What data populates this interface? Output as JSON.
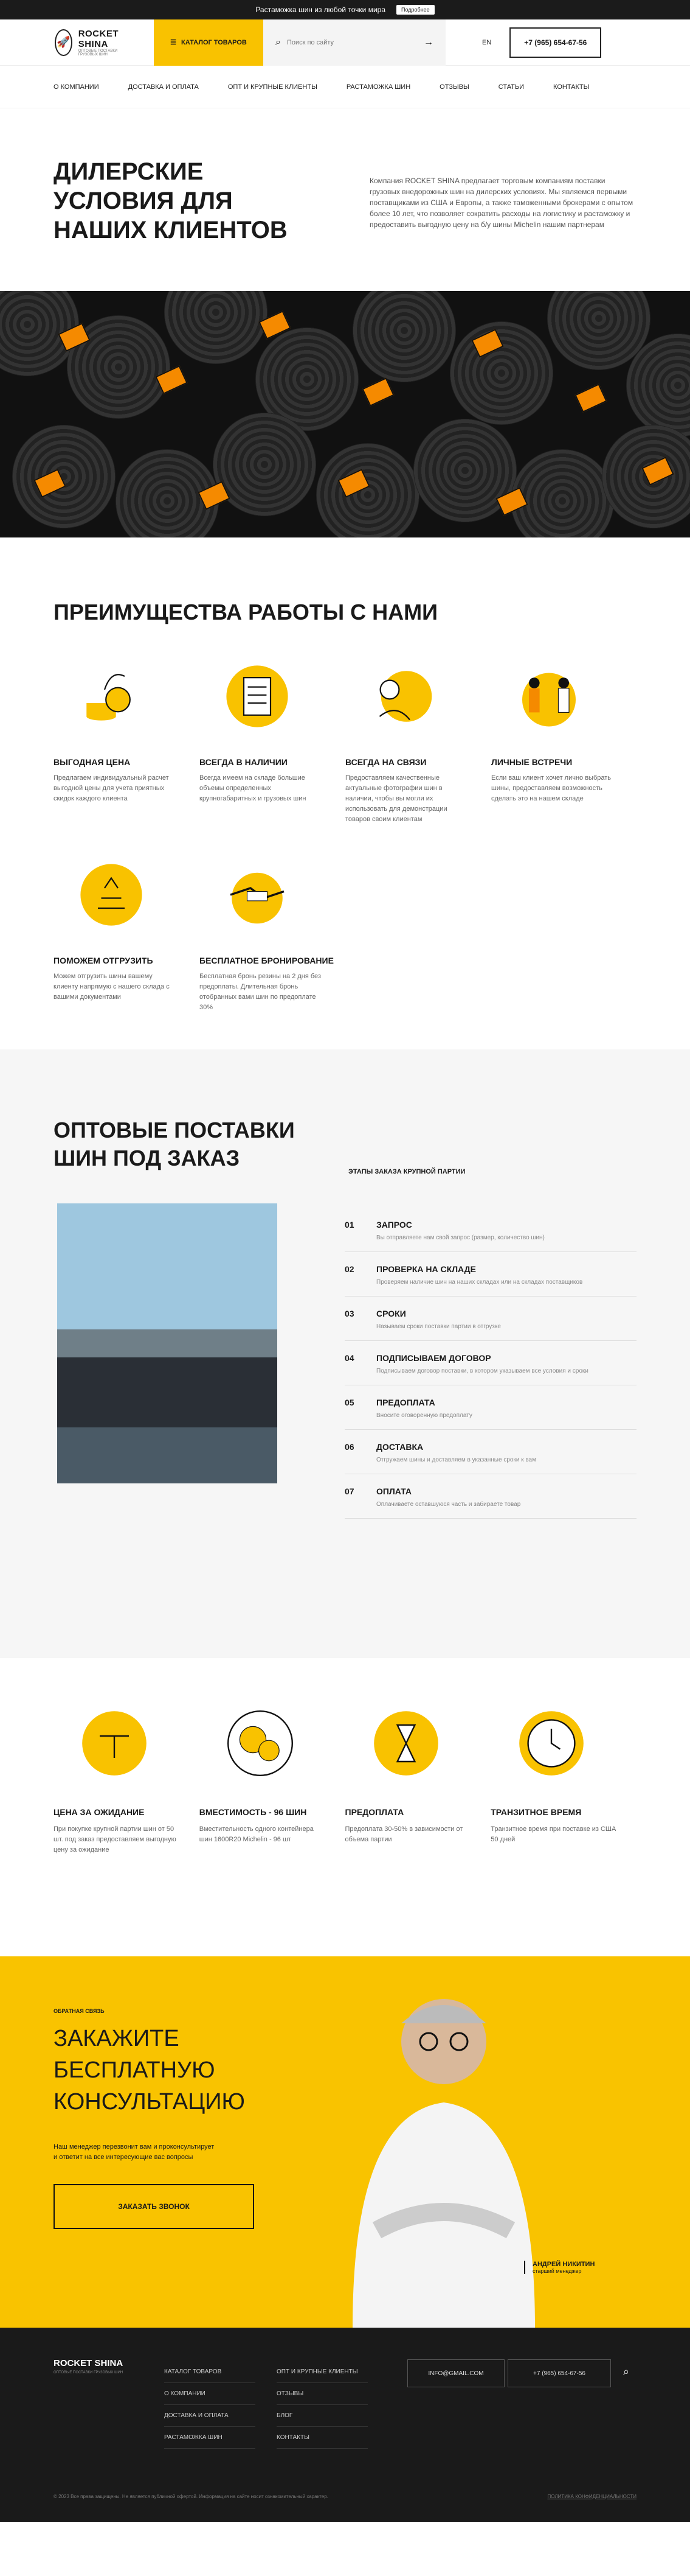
{
  "topbar": {
    "text": "Растаможка шин из любой точки мира",
    "button": "Подробнее"
  },
  "header": {
    "logo_big": "ROCKET SHINA",
    "logo_small": "ОПТОВЫЕ ПОСТАВКИ ГРУЗОВЫХ ШИН",
    "catalog": "КАТАЛОГ ТОВАРОВ",
    "search_placeholder": "Поиск по сайту",
    "lang": "EN",
    "phone": "+7 (965) 654-67-56"
  },
  "nav": [
    "О КОМПАНИИ",
    "ДОСТАВКА И ОПЛАТА",
    "ОПТ И КРУПНЫЕ КЛИЕНТЫ",
    "РАСТАМОЖКА ШИН",
    "ОТЗЫВЫ",
    "СТАТЬИ",
    "КОНТАКТЫ"
  ],
  "hero": {
    "title": "ДИЛЕРСКИЕ УСЛОВИЯ ДЛЯ НАШИХ КЛИЕНТОВ",
    "text": "Компания ROCKET SHINA предлагает торговым компаниям поставки грузовых внедорожных шин на дилерских условиях. Мы являемся первыми поставщиками из США и Европы, а также таможенными брокерами с опытом более 10 лет, что позволяет сократить расходы на логистику и растаможку и предоставить выгодную цену на б/у шины Michelin нашим партнерам"
  },
  "advantages": {
    "title": "ПРЕИМУЩЕСТВА РАБОТЫ С НАМИ",
    "items": [
      {
        "icon": "coins-icon",
        "title": "ВЫГОДНАЯ ЦЕНА",
        "text": "Предлагаем индивидуальный расчет выгодной цены для учета приятных скидок каждого клиента"
      },
      {
        "icon": "checklist-icon",
        "title": "ВСЕГДА В НАЛИЧИИ",
        "text": "Всегда имеем на складе большие объемы определенных крупногабаритных и грузовых шин"
      },
      {
        "icon": "contact-icon",
        "title": "ВСЕГДА НА СВЯЗИ",
        "text": "Предоставляем качественные актуальные фотографии шин в наличии, чтобы вы могли их использовать для демонстрации товаров своим клиентам"
      },
      {
        "icon": "meeting-icon",
        "title": "ЛИЧНЫЕ ВСТРЕЧИ",
        "text": "Если ваш клиент хочет лично выбрать шины, предоставляем возможность сделать это на нашем складе"
      },
      {
        "icon": "shipping-icon",
        "title": "ПОМОЖЕМ ОТГРУЗИТЬ",
        "text": "Можем отгрузить шины вашему клиенту напрямую с нашего склада с вашими документами"
      },
      {
        "icon": "handshake-icon",
        "title": "БЕСПЛАТНОЕ БРОНИРОВАНИЕ",
        "text": "Бесплатная бронь резины на 2 дня без предоплаты. Длительная бронь отобранных вами шин по предоплате 30%"
      }
    ]
  },
  "wholesale": {
    "title": "ОПТОВЫЕ ПОСТАВКИ ШИН ПОД ЗАКАЗ",
    "stages_title": "ЭТАПЫ ЗАКАЗА КРУПНОЙ ПАРТИИ",
    "stages": [
      {
        "n": "01",
        "title": "ЗАПРОС",
        "text": "Вы отправляете нам свой запрос (размер, количество шин)"
      },
      {
        "n": "02",
        "title": "ПРОВЕРКА НА СКЛАДЕ",
        "text": "Проверяем наличие шин на наших складах или на складах поставщиков"
      },
      {
        "n": "03",
        "title": "СРОКИ",
        "text": "Называем сроки поставки партии в отгрузке"
      },
      {
        "n": "04",
        "title": "ПОДПИСЫВАЕМ ДОГОВОР",
        "text": "Подписываем договор поставки, в котором указываем все условия и сроки"
      },
      {
        "n": "05",
        "title": "ПРЕДОПЛАТА",
        "text": "Вносите оговоренную предоплату"
      },
      {
        "n": "06",
        "title": "ДОСТАВКА",
        "text": "Отгружаем шины и доставляем в указанные сроки к вам"
      },
      {
        "n": "07",
        "title": "ОПЛАТА",
        "text": "Оплачиваете оставшуюся часть и забираете товар"
      }
    ]
  },
  "stats": [
    {
      "icon": "wait-price-icon",
      "title": "ЦЕНА ЗА ОЖИДАНИЕ",
      "text": "При покупке крупной партии шин от 50 шт. под заказ предоставляем выгодную цену за ожидание"
    },
    {
      "icon": "tires-icon",
      "title": "ВМЕСТИМОСТЬ - 96 ШИН",
      "text": "Вместительность одного контейнера шин 1600R20 Michelin - 96 шт"
    },
    {
      "icon": "hourglass-icon",
      "title": "ПРЕДОПЛАТА",
      "text": "Предоплата 30-50% в зависимости от объема партии"
    },
    {
      "icon": "clock-icon",
      "title": "ТРАНЗИТНОЕ ВРЕМЯ",
      "text": "Транзитное время при поставке из США 50 дней"
    }
  ],
  "cta": {
    "label": "ОБРАТНАЯ СВЯЗЬ",
    "title": "ЗАКАЖИТЕ БЕСПЛАТНУЮ КОНСУЛЬТАЦИЮ",
    "text": "Наш менеджер перезвонит вам и проконсультирует и ответит на все интересующие вас вопросы",
    "button": "ЗАКАЗАТЬ ЗВОНОК",
    "manager_name": "АНДРЕЙ НИКИТИН",
    "manager_role": "старший менеджер"
  },
  "footer": {
    "logo": "ROCKET SHINA",
    "logo_small": "ОПТОВЫЕ ПОСТАВКИ ГРУЗОВЫХ ШИН",
    "col1": [
      "КАТАЛОГ ТОВАРОВ",
      "О КОМПАНИИ",
      "ДОСТАВКА И ОПЛАТА",
      "РАСТАМОЖКА ШИН"
    ],
    "col2": [
      "ОПТ И КРУПНЫЕ КЛИЕНТЫ",
      "ОТЗЫВЫ",
      "БЛОГ",
      "КОНТАКТЫ"
    ],
    "email": "INFO@GMAIL.COM",
    "phone": "+7 (965) 654-67-56",
    "copyright": "© 2023 Все права защищены. Не является публичной офертой. Информация на сайте носит ознакомительный характер.",
    "privacy": "ПОЛИТИКА КОНФИДЕНЦИАЛЬНОСТИ"
  }
}
